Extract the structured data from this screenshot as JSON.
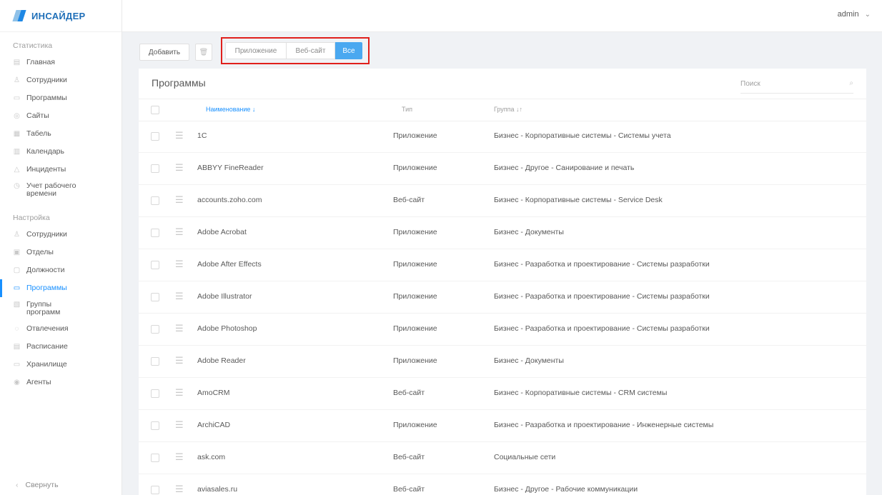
{
  "app": {
    "logo_text": "ИНСАЙДЕР",
    "accent_color": "#1890ff",
    "highlight_color": "#e0201c"
  },
  "header": {
    "user": "admin"
  },
  "sidebar": {
    "stats_title": "Статистика",
    "stats_items": [
      {
        "label": "Главная",
        "icon": "dashboard-icon"
      },
      {
        "label": "Сотрудники",
        "icon": "user-icon"
      },
      {
        "label": "Программы",
        "icon": "programs-icon"
      },
      {
        "label": "Сайты",
        "icon": "globe-icon"
      },
      {
        "label": "Табель",
        "icon": "table-icon"
      },
      {
        "label": "Календарь",
        "icon": "calendar-icon"
      },
      {
        "label": "Инциденты",
        "icon": "warning-icon"
      },
      {
        "label": "Учет рабочего\nвремени",
        "icon": "clock-icon"
      }
    ],
    "settings_title": "Настройка",
    "settings_items": [
      {
        "label": "Сотрудники",
        "icon": "user-icon"
      },
      {
        "label": "Отделы",
        "icon": "departments-icon"
      },
      {
        "label": "Должности",
        "icon": "positions-icon"
      },
      {
        "label": "Программы",
        "icon": "programs-icon",
        "active": true
      },
      {
        "label": "Группы\nпрограмм",
        "icon": "groups-icon"
      },
      {
        "label": "Отвлечения",
        "icon": "distraction-icon"
      },
      {
        "label": "Расписание",
        "icon": "schedule-icon"
      },
      {
        "label": "Хранилище",
        "icon": "storage-icon"
      },
      {
        "label": "Агенты",
        "icon": "agent-icon"
      }
    ],
    "collapse_label": "Свернуть"
  },
  "toolbar": {
    "add_label": "Добавить",
    "filter": {
      "options": [
        "Приложение",
        "Веб-сайт",
        "Все"
      ],
      "selected": "Все"
    }
  },
  "panel": {
    "title": "Программы",
    "search_placeholder": "Поиск",
    "columns": {
      "name": "Наименование ↓",
      "type": "Тип",
      "group": "Группа ↓↑"
    },
    "rows": [
      {
        "name": "1C",
        "type": "Приложение",
        "group": "Бизнес - Корпоративные системы - Системы учета"
      },
      {
        "name": "ABBYY FineReader",
        "type": "Приложение",
        "group": "Бизнес - Другое - Санирование и печать"
      },
      {
        "name": "accounts.zoho.com",
        "type": "Веб-сайт",
        "group": "Бизнес - Корпоративные системы - Service Desk"
      },
      {
        "name": "Adobe Acrobat",
        "type": "Приложение",
        "group": "Бизнес - Документы"
      },
      {
        "name": "Adobe After Effects",
        "type": "Приложение",
        "group": "Бизнес - Разработка и проектирование - Системы разработки"
      },
      {
        "name": "Adobe Illustrator",
        "type": "Приложение",
        "group": "Бизнес - Разработка и проектирование - Системы разработки"
      },
      {
        "name": "Adobe Photoshop",
        "type": "Приложение",
        "group": "Бизнес - Разработка и проектирование - Системы разработки"
      },
      {
        "name": "Adobe Reader",
        "type": "Приложение",
        "group": "Бизнес - Документы"
      },
      {
        "name": "AmoCRM",
        "type": "Веб-сайт",
        "group": "Бизнес - Корпоративные системы - CRM системы"
      },
      {
        "name": "ArchiCAD",
        "type": "Приложение",
        "group": "Бизнес - Разработка и проектирование - Инженерные системы"
      },
      {
        "name": "ask.com",
        "type": "Веб-сайт",
        "group": "Социальные сети"
      },
      {
        "name": "aviasales.ru",
        "type": "Веб-сайт",
        "group": "Бизнес - Другое - Рабочие коммуникации"
      }
    ]
  }
}
